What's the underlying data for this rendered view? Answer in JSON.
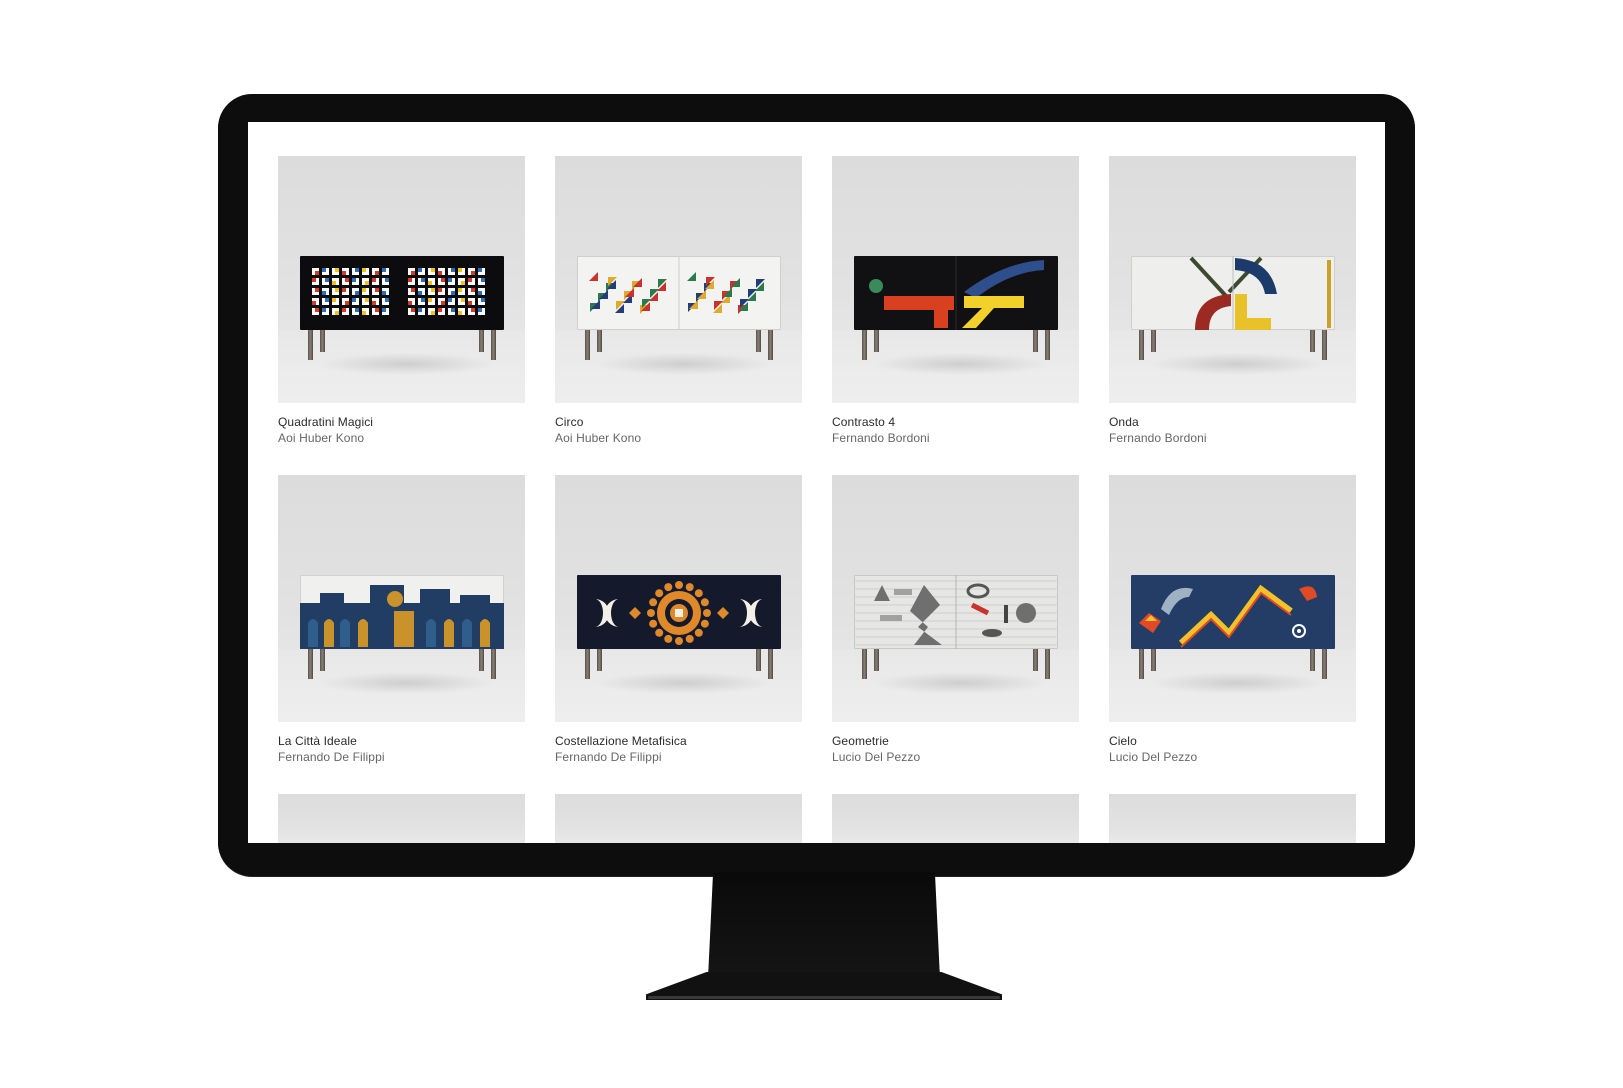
{
  "gallery": {
    "items": [
      {
        "title": "Quadratini Magici",
        "artist": "Aoi Huber Kono",
        "body": "#0c0c0e",
        "accent": [
          "#d63b2a",
          "#2f6fb5",
          "#f0c419",
          "#ffffff"
        ]
      },
      {
        "title": "Circo",
        "artist": "Aoi Huber Kono",
        "body": "#f3f3f1",
        "accent": [
          "#c9332b",
          "#2a7a4b",
          "#243d7a",
          "#e0a92c"
        ]
      },
      {
        "title": "Contrasto 4",
        "artist": "Fernando Bordoni",
        "body": "#111114",
        "accent": [
          "#d9401f",
          "#f2d12a",
          "#2e4f8c",
          "#3a8a5a"
        ]
      },
      {
        "title": "Onda",
        "artist": "Fernando Bordoni",
        "body": "#eeeeec",
        "accent": [
          "#9b2a22",
          "#e9c22a",
          "#1c3b6a",
          "#3b4a2f"
        ]
      },
      {
        "title": "La Città Ideale",
        "artist": "Fernando De Filippi",
        "body": "#f0f0ee",
        "accent": [
          "#223d63",
          "#c9922b",
          "#e9e6df",
          "#2f5e8c"
        ]
      },
      {
        "title": "Costellazione Metafisica",
        "artist": "Fernando De Filippi",
        "body": "#141a2c",
        "accent": [
          "#e0892a",
          "#f4f0e6",
          "#c1701e",
          "#1c2440"
        ]
      },
      {
        "title": "Geometrie",
        "artist": "Lucio Del Pezzo",
        "body": "#e6e6e4",
        "accent": [
          "#6f6f6f",
          "#a1a1a1",
          "#c8342b",
          "#444444"
        ]
      },
      {
        "title": "Cielo",
        "artist": "Lucio Del Pezzo",
        "body": "#243d66",
        "accent": [
          "#f2c12b",
          "#e04a25",
          "#9fb2c4",
          "#ffffff"
        ]
      }
    ],
    "partial_count": 4
  }
}
